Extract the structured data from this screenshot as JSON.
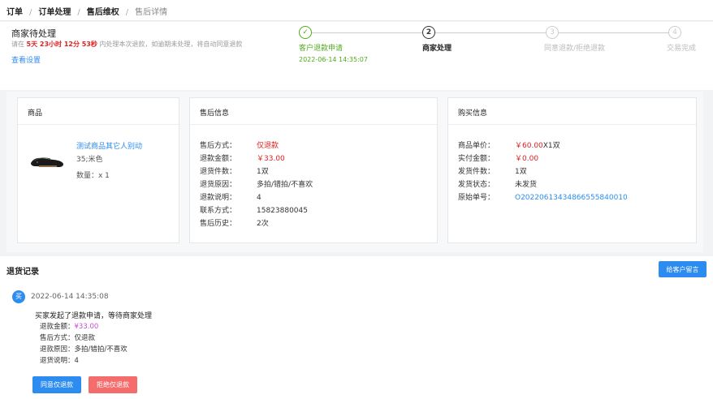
{
  "breadcrumb": {
    "items": [
      "订单",
      "订单处理",
      "售后维权"
    ],
    "current": "售后详情"
  },
  "status": {
    "title": "商家待处理",
    "countdown_prefix": "请在",
    "countdown_time": "5天 23小时 12分 53秒",
    "countdown_suffix": "内处理本次退款，如逾期未处理，将自动同意退款",
    "view_settings": "查看设置"
  },
  "steps": [
    {
      "num": "✓",
      "label": "客户退款申请",
      "date": "2022-06-14 14:35:07",
      "state": "done"
    },
    {
      "num": "2",
      "label": "商家处理",
      "date": "",
      "state": "active"
    },
    {
      "num": "3",
      "label": "同意退款/拒绝退款",
      "date": "",
      "state": "pending"
    },
    {
      "num": "4",
      "label": "交易完成",
      "date": "",
      "state": "pending"
    }
  ],
  "product_card": {
    "title": "商品",
    "name": "测试商品其它人别动",
    "spec": "35;米色",
    "qty": "数量：x 1",
    "image_icon": "shoe-icon"
  },
  "aftersale_card": {
    "title": "售后信息",
    "rows": [
      {
        "k": "售后方式：",
        "v": "仅退款",
        "style": "red"
      },
      {
        "k": "退款金额：",
        "v": "￥33.00",
        "style": "red"
      },
      {
        "k": "退货件数：",
        "v": "1双",
        "style": ""
      },
      {
        "k": "退货原因：",
        "v": "多拍/错拍/不喜欢",
        "style": ""
      },
      {
        "k": "退款说明：",
        "v": "4",
        "style": ""
      },
      {
        "k": "联系方式：",
        "v": "15823880045",
        "style": ""
      },
      {
        "k": "售后历史：",
        "v": "2次",
        "style": ""
      }
    ]
  },
  "purchase_card": {
    "title": "购买信息",
    "rows": [
      {
        "k": "商品单价：",
        "v": "￥60.00",
        "v2": "X1双",
        "style": "red"
      },
      {
        "k": "实付金额：",
        "v": "￥0.00",
        "v2": "",
        "style": "red"
      },
      {
        "k": "发货件数：",
        "v": "1双",
        "v2": "",
        "style": ""
      },
      {
        "k": "发货状态：",
        "v": "未发货",
        "v2": "",
        "style": ""
      },
      {
        "k": "原始单号：",
        "v": "O202206134348665558400​10",
        "v2": "",
        "style": "link"
      }
    ]
  },
  "records": {
    "title": "退货记录",
    "leave_msg_label": "给客户留言",
    "avatar_label": "买",
    "time": "2022-06-14 14:35:08",
    "heading": "买家发起了退款申请，等待商家处理",
    "lines": [
      {
        "k": "退款金额：",
        "v": "¥33.00",
        "style": "pink"
      },
      {
        "k": "售后方式：",
        "v": "仅退款",
        "style": ""
      },
      {
        "k": "退款原因：",
        "v": "多拍/错拍/不喜欢",
        "style": ""
      },
      {
        "k": "退货说明：",
        "v": "4",
        "style": ""
      }
    ],
    "agree_label": "同意仅退款",
    "reject_label": "拒绝仅退款"
  }
}
